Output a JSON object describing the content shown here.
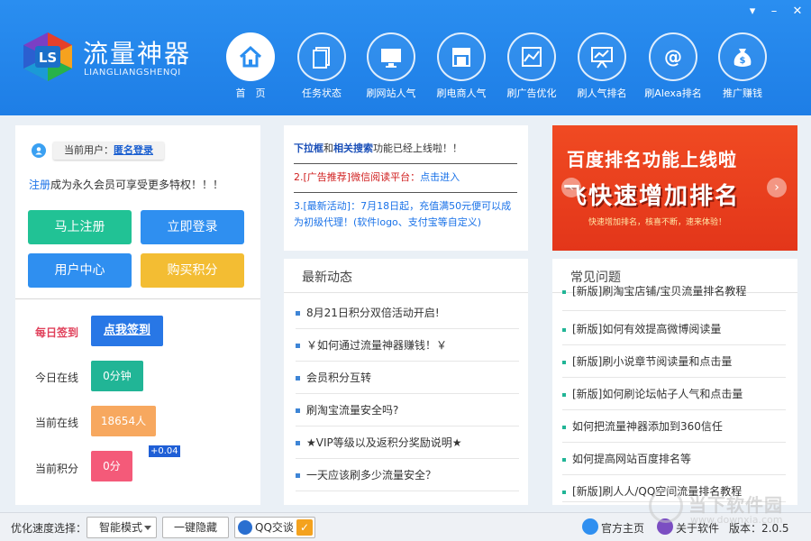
{
  "app": {
    "title": "流量神器",
    "subtitle": "LIANGLIANGSHENQI",
    "colors": {
      "header": "#1e7ee6",
      "accent": "#2f8ff0",
      "green": "#21c295",
      "yellow": "#f3bd33",
      "red": "#f45a79"
    }
  },
  "window_controls": {
    "menu_icon": "▾",
    "minimize_icon": "–",
    "close_icon": "✕"
  },
  "nav": [
    {
      "label": "首　页",
      "icon": "home-icon"
    },
    {
      "label": "任务状态",
      "icon": "document-icon"
    },
    {
      "label": "刷网站人气",
      "icon": "monitor-icon"
    },
    {
      "label": "刷电商人气",
      "icon": "store-icon"
    },
    {
      "label": "刷广告优化",
      "icon": "chart-icon"
    },
    {
      "label": "刷人气排名",
      "icon": "presentation-icon"
    },
    {
      "label": "刷Alexa排名",
      "icon": "at-icon"
    },
    {
      "label": "推广赚钱",
      "icon": "money-bag-icon"
    }
  ],
  "user": {
    "label": "当前用户：",
    "name": "匿名登录",
    "promo_link": "注册",
    "promo_text": "成为永久会员可享受更多特权！！！"
  },
  "buttons": {
    "register": "马上注册",
    "login": "立即登录",
    "user_center": "用户中心",
    "buy_points": "购买积分"
  },
  "stats": {
    "daily_signin_label": "每日签到",
    "signin_button": "点我签到",
    "today_online_label": "今日在线",
    "today_online_value": "0分钟",
    "current_online_label": "当前在线",
    "current_online_value": "18654人",
    "current_points_label": "当前积分",
    "current_points_value": "0分",
    "points_bonus": "+0.04"
  },
  "notices": {
    "n1_a": "下拉框",
    "n1_b": "和",
    "n1_c": "相关搜索",
    "n1_d": "功能已经上线啦！！",
    "n2_prefix": "2.",
    "n2_label": "[广告推荐]",
    "n2_text": "微信阅读平台：",
    "n2_cta": "点击进入",
    "n3": "3.[最新活动]：7月18日起，充值满50元便可以成为初级代理！(软件logo、支付宝等自定义)"
  },
  "news": {
    "title": "最新动态",
    "items": [
      "8月21日积分双倍活动开启!",
      "￥如何通过流量神器赚钱！￥",
      "会员积分互转",
      "刷淘宝流量安全吗?",
      "★VIP等级以及返积分奖励说明★",
      "一天应该刷多少流量安全？"
    ]
  },
  "banner": {
    "line1": "百度排名功能上线啦",
    "line2": "飞快速增加排名",
    "line3": "快速增加排名，核喜不断，速来体验！"
  },
  "faq": {
    "title": "常见问题",
    "items": [
      "[新版]刷淘宝店铺/宝贝流量排名教程",
      "[新版]如何有效提高微博阅读量",
      "[新版]刷小说章节阅读量和点击量",
      "[新版]如何刷论坛帖子人气和点击量",
      "如何把流量神器添加到360信任",
      "如何提高网站百度排名等",
      "[新版]刷人人/QQ空间流量排名教程"
    ]
  },
  "footer": {
    "speed_label": "优化速度选择：",
    "speed_mode": "智能模式",
    "hide_button": "一键隐藏",
    "qq_button": "QQ交谈",
    "home_link": "官方主页",
    "about_link": "关于软件",
    "version": "版本：2.0.5"
  },
  "watermark": {
    "text": "当下软件园",
    "url": "www.downxia.com"
  }
}
